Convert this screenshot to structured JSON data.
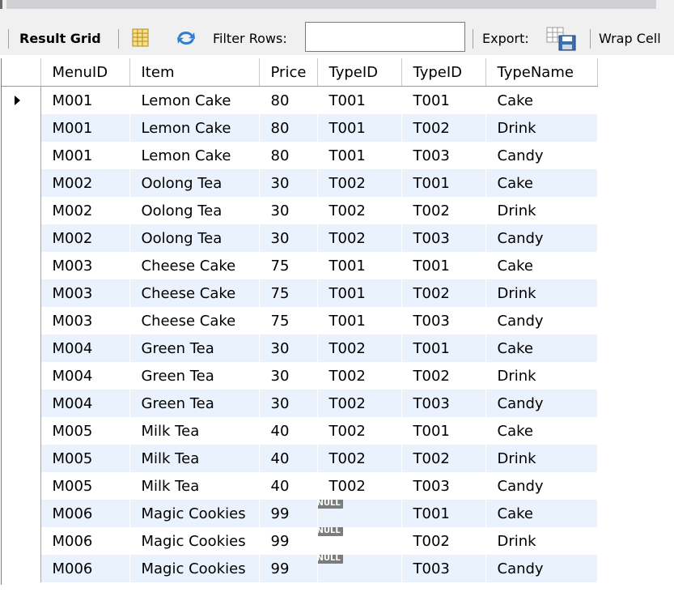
{
  "toolbar": {
    "result_grid_label": "Result Grid",
    "filter_rows_label": "Filter Rows:",
    "filter_value": "",
    "export_label": "Export:",
    "wrap_cell_label": "Wrap Cell"
  },
  "grid": {
    "columns": [
      "MenuID",
      "Item",
      "Price",
      "TypeID",
      "TypeID",
      "TypeName"
    ],
    "rows": [
      [
        "M001",
        "Lemon Cake",
        "80",
        "T001",
        "T001",
        "Cake"
      ],
      [
        "M001",
        "Lemon Cake",
        "80",
        "T001",
        "T002",
        "Drink"
      ],
      [
        "M001",
        "Lemon Cake",
        "80",
        "T001",
        "T003",
        "Candy"
      ],
      [
        "M002",
        "Oolong Tea",
        "30",
        "T002",
        "T001",
        "Cake"
      ],
      [
        "M002",
        "Oolong Tea",
        "30",
        "T002",
        "T002",
        "Drink"
      ],
      [
        "M002",
        "Oolong Tea",
        "30",
        "T002",
        "T003",
        "Candy"
      ],
      [
        "M003",
        "Cheese Cake",
        "75",
        "T001",
        "T001",
        "Cake"
      ],
      [
        "M003",
        "Cheese Cake",
        "75",
        "T001",
        "T002",
        "Drink"
      ],
      [
        "M003",
        "Cheese Cake",
        "75",
        "T001",
        "T003",
        "Candy"
      ],
      [
        "M004",
        "Green Tea",
        "30",
        "T002",
        "T001",
        "Cake"
      ],
      [
        "M004",
        "Green Tea",
        "30",
        "T002",
        "T002",
        "Drink"
      ],
      [
        "M004",
        "Green Tea",
        "30",
        "T002",
        "T003",
        "Candy"
      ],
      [
        "M005",
        "Milk Tea",
        "40",
        "T002",
        "T001",
        "Cake"
      ],
      [
        "M005",
        "Milk Tea",
        "40",
        "T002",
        "T002",
        "Drink"
      ],
      [
        "M005",
        "Milk Tea",
        "40",
        "T002",
        "T003",
        "Candy"
      ],
      [
        "M006",
        "Magic Cookies",
        "99",
        "NULL",
        "T001",
        "Cake"
      ],
      [
        "M006",
        "Magic Cookies",
        "99",
        "NULL",
        "T002",
        "Drink"
      ],
      [
        "M006",
        "Magic Cookies",
        "99",
        "NULL",
        "T003",
        "Candy"
      ]
    ],
    "selected_row": 0,
    "null_label": "NULL"
  },
  "colors": {
    "alt_row": "#eaf2fd",
    "toolbar_bg": "#f0f0f0",
    "null_badge": "#7c7c7c"
  }
}
